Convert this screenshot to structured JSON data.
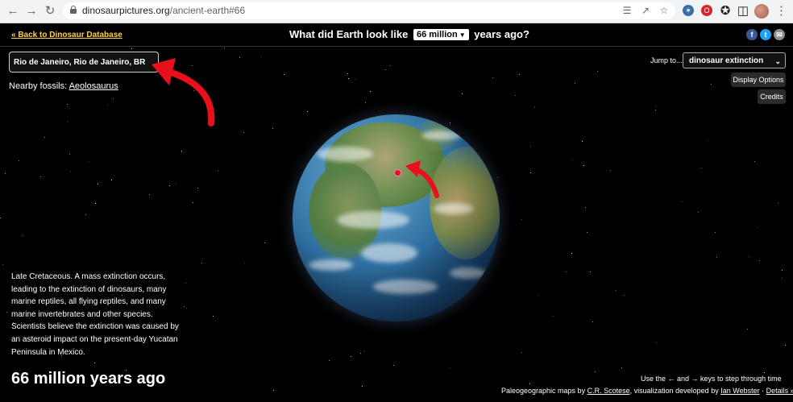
{
  "browser": {
    "url_host": "dinosaurpictures.org",
    "url_path": "/ancient-earth#66"
  },
  "topbar": {
    "back_link": "« Back to Dinosaur Database",
    "headline_before": "What did Earth look like",
    "year_select": "66 million",
    "headline_after": "years ago?"
  },
  "location": {
    "value": "Rio de Janeiro, Rio de Janeiro, BR",
    "nearby_label": "Nearby fossils:",
    "nearby_fossil": "Aeolosaurus"
  },
  "controls": {
    "jump_label": "Jump to...",
    "jump_value": "dinosaur extinction",
    "display_options": "Display Options",
    "credits": "Credits"
  },
  "era": {
    "description": "Late Cretaceous. A mass extinction occurs, leading to the extinction of dinosaurs, many marine reptiles, all flying reptiles, and many marine invertebrates and other species. Scientists believe the extinction was caused by an asteroid impact on the present-day Yucatan Peninsula in Mexico.",
    "title": "66 million years ago"
  },
  "footer": {
    "keys_hint": "Use the ← and → keys to step through time",
    "credits_prefix": "Paleogeographic maps by",
    "credits_scotese": "C.R. Scotese",
    "credits_middle": ", visualization developed by",
    "credits_webster": "Ian Webster",
    "credits_sep": "·",
    "details_link": "Details »"
  },
  "colors": {
    "annotation_arrow": "#e8101a",
    "back_link": "#ffd24a",
    "marker": "#e01030"
  }
}
